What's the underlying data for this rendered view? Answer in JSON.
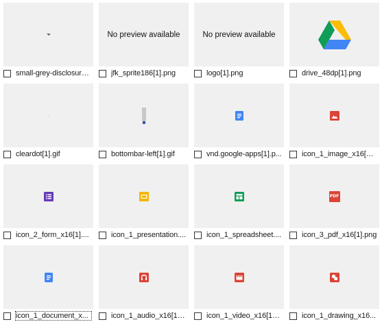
{
  "thumbnails": [
    {
      "name": "small-grey-disclosure-...",
      "preview": "chevron"
    },
    {
      "name": "jfk_sprite186[1].png",
      "preview": "none"
    },
    {
      "name": "logo[1].png",
      "preview": "none"
    },
    {
      "name": "drive_48dp[1].png",
      "preview": "drive"
    },
    {
      "name": "cleardot[1].gif",
      "preview": "dot"
    },
    {
      "name": "bottombar-left[1].gif",
      "preview": "bar"
    },
    {
      "name": "vnd.google-apps[1].p...",
      "preview": "doc-blue"
    },
    {
      "name": "icon_1_image_x16[1]....",
      "preview": "image-red"
    },
    {
      "name": "icon_2_form_x16[1]....",
      "preview": "form-purple"
    },
    {
      "name": "icon_1_presentation....",
      "preview": "slides-yellow"
    },
    {
      "name": "icon_1_spreadsheet....",
      "preview": "sheet-green"
    },
    {
      "name": "icon_3_pdf_x16[1].png",
      "preview": "pdf-red"
    },
    {
      "name": "icon_1_document_x...",
      "preview": "doc-blue"
    },
    {
      "name": "icon_1_audio_x16[1]....",
      "preview": "audio-red"
    },
    {
      "name": "icon_1_video_x16[1]....",
      "preview": "video-red"
    },
    {
      "name": "icon_1_drawing_x16...",
      "preview": "drawing-red"
    }
  ],
  "no_preview_text": "No preview available",
  "pdf_label": "PDF",
  "colors": {
    "thumb_bg": "#f0f0f0",
    "blue": "#4285f4",
    "red": "#db4437",
    "green": "#0f9d58",
    "yellow": "#f4b400",
    "purple": "#673ab7"
  }
}
